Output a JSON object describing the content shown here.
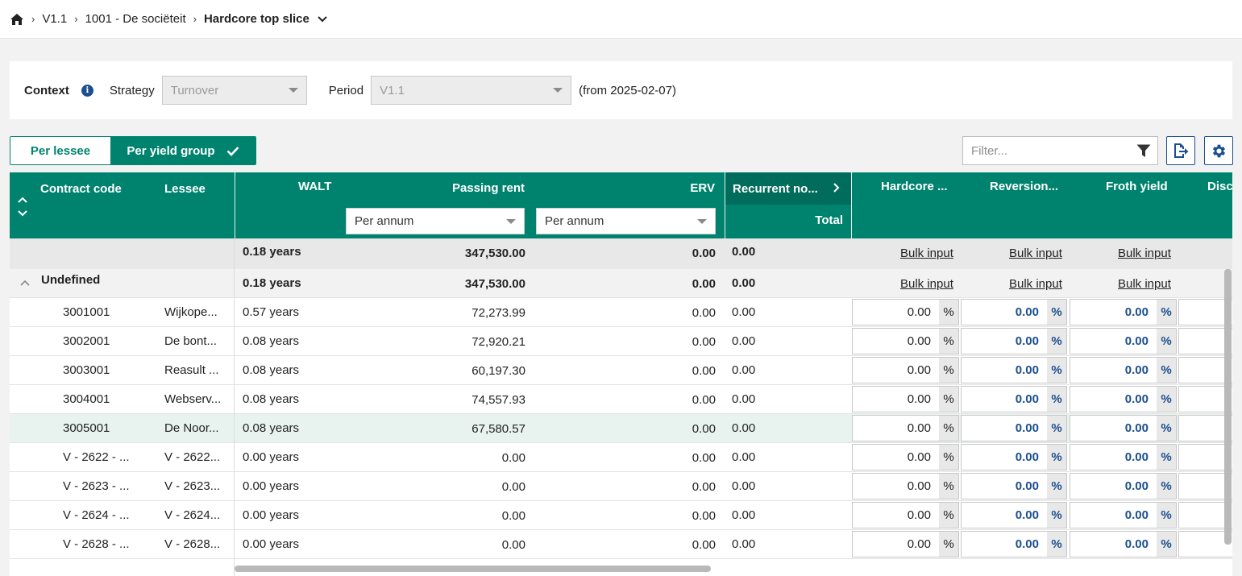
{
  "breadcrumb": {
    "items": [
      "V1.1",
      "1001 - De sociëteit",
      "Hardcore top slice"
    ]
  },
  "context": {
    "label": "Context",
    "strategy_label": "Strategy",
    "strategy_value": "Turnover",
    "period_label": "Period",
    "period_value": "V1.1",
    "period_from": "(from 2025-02-07)"
  },
  "view_toggle": {
    "per_lessee": "Per lessee",
    "per_yield_group": "Per yield group",
    "selected": "Per yield group"
  },
  "filter": {
    "placeholder": "Filter..."
  },
  "columns": {
    "contract_code": "Contract code",
    "lessee": "Lessee",
    "walt": "WALT",
    "passing_rent": "Passing rent",
    "erv": "ERV",
    "recurrent": "Recurrent no...",
    "total": "Total",
    "hardcore": "Hardcore ...",
    "reversion": "Reversion...",
    "froth_yield": "Froth yield",
    "disc": "Disc",
    "passing_rent_period": "Per annum",
    "erv_period": "Per annum",
    "bulk_input": "Bulk input"
  },
  "totals_row": {
    "walt": "0.18 years",
    "passing_rent": "347,530.00",
    "erv": "0.00",
    "recurrent": "0.00"
  },
  "group_row": {
    "name": "Undefined",
    "walt": "0.18 years",
    "passing_rent": "347,530.00",
    "erv": "0.00",
    "recurrent": "0.00"
  },
  "rows": [
    {
      "code": "3001001",
      "lessee": "Wijkope...",
      "walt": "0.57 years",
      "rent": "72,273.99",
      "erv": "0.00",
      "rec": "0.00",
      "hardcore": "0.00",
      "reversion": "0.00",
      "froth": "0.00",
      "unit": "%"
    },
    {
      "code": "3002001",
      "lessee": "De bont...",
      "walt": "0.08 years",
      "rent": "72,920.21",
      "erv": "0.00",
      "rec": "0.00",
      "hardcore": "0.00",
      "reversion": "0.00",
      "froth": "0.00",
      "unit": "%"
    },
    {
      "code": "3003001",
      "lessee": "Reasult ...",
      "walt": "0.08 years",
      "rent": "60,197.30",
      "erv": "0.00",
      "rec": "0.00",
      "hardcore": "0.00",
      "reversion": "0.00",
      "froth": "0.00",
      "unit": "%"
    },
    {
      "code": "3004001",
      "lessee": "Webserv...",
      "walt": "0.08 years",
      "rent": "74,557.93",
      "erv": "0.00",
      "rec": "0.00",
      "hardcore": "0.00",
      "reversion": "0.00",
      "froth": "0.00",
      "unit": "%"
    },
    {
      "code": "3005001",
      "lessee": "De Noor...",
      "walt": "0.08 years",
      "rent": "67,580.57",
      "erv": "0.00",
      "rec": "0.00",
      "hardcore": "0.00",
      "reversion": "0.00",
      "froth": "0.00",
      "unit": "%"
    },
    {
      "code": "V - 2622 - ...",
      "lessee": "V - 2622...",
      "walt": "0.00 years",
      "rent": "0.00",
      "erv": "0.00",
      "rec": "0.00",
      "hardcore": "0.00",
      "reversion": "0.00",
      "froth": "0.00",
      "unit": "%"
    },
    {
      "code": "V - 2623 - ...",
      "lessee": "V - 2623...",
      "walt": "0.00 years",
      "rent": "0.00",
      "erv": "0.00",
      "rec": "0.00",
      "hardcore": "0.00",
      "reversion": "0.00",
      "froth": "0.00",
      "unit": "%"
    },
    {
      "code": "V - 2624 - ...",
      "lessee": "V - 2624...",
      "walt": "0.00 years",
      "rent": "0.00",
      "erv": "0.00",
      "rec": "0.00",
      "hardcore": "0.00",
      "reversion": "0.00",
      "froth": "0.00",
      "unit": "%"
    },
    {
      "code": "V - 2628 - ...",
      "lessee": "V - 2628...",
      "walt": "0.00 years",
      "rent": "0.00",
      "erv": "0.00",
      "rec": "0.00",
      "hardcore": "0.00",
      "reversion": "0.00",
      "froth": "0.00",
      "unit": "%"
    }
  ],
  "icons": {
    "home": "home-icon",
    "chevron_down": "chevron-down-icon",
    "info": "info-icon",
    "check": "check-icon",
    "filter": "filter-icon",
    "export": "export-icon",
    "settings": "gear-icon"
  },
  "colors": {
    "accent": "#00836e",
    "accent_dark": "#006c5b",
    "link": "#1c4f8f",
    "row_highlight": "#e8f3ef"
  },
  "highlighted_row": 4
}
